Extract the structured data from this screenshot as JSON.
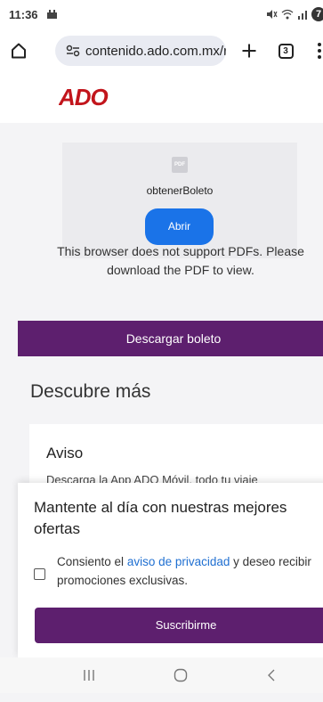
{
  "status_bar": {
    "time": "11:36",
    "battery": "7"
  },
  "browser": {
    "url": "contenido.ado.com.mx/r",
    "tab_count": "3"
  },
  "brand": {
    "logo_text": "ADO",
    "logo_color": "#c2151c"
  },
  "pdf_viewer": {
    "icon_label": "PDF",
    "file_name": "obtenerBoleto",
    "open_label": "Abrir",
    "unsupported_message": "This browser does not support PDFs. Please download the PDF to view."
  },
  "download_button": "Descargar boleto",
  "discover": {
    "title": "Descubre más",
    "notice_title": "Aviso",
    "notice_text": "Descarga la App ADO Móvil, todo tu viaje"
  },
  "subscribe_sheet": {
    "title": "Mantente al día con nuestras mejores ofertas",
    "consent_prefix": "Consiento el ",
    "consent_link": "aviso de privacidad",
    "consent_suffix": " y deseo recibir promociones exclusivas.",
    "consent_checked": false,
    "button_label": "Suscribirme"
  },
  "colors": {
    "primary_purple": "#5d1f6e",
    "link_blue": "#1f6fd1",
    "open_button_blue": "#1a73e8"
  },
  "icons": [
    "home-icon",
    "site-settings-icon",
    "new-tab-icon",
    "tab-switcher-icon",
    "overflow-menu-icon",
    "recents-icon",
    "home-nav-icon",
    "back-icon"
  ]
}
